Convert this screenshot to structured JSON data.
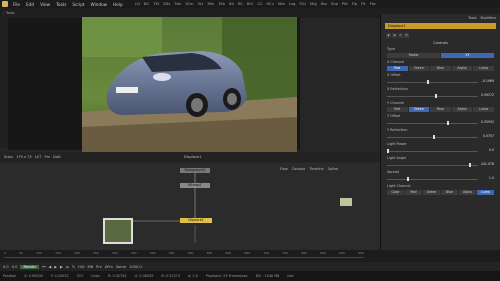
{
  "menubar": {
    "items": [
      "File",
      "Edit",
      "View",
      "Tools",
      "Script",
      "Window",
      "Help"
    ],
    "tool_labels": [
      "LD",
      "BG",
      "TXt",
      "3Dx",
      "3Im",
      "3Cm",
      "3Lt",
      "3Rn",
      "3Sh",
      "Blr",
      "BC",
      "BrC",
      "CC",
      "HCv",
      "Msk",
      "Lng",
      "FLU",
      "Mrg",
      "Rsz",
      "Shp",
      "Pht",
      "Flp",
      "Flt",
      "Flw"
    ]
  },
  "toolbar": {
    "items": [
      "Tools",
      "",
      "",
      "",
      "",
      "",
      "",
      "",
      "",
      "",
      "Tools",
      "Modifiers",
      "",
      "",
      "Script"
    ],
    "right_tabs": [
      "Tools",
      "Modifiers"
    ]
  },
  "viewer": {
    "zoom": "Subv",
    "res": "179 x 75",
    "lut": "LUT",
    "proxy": "Prx",
    "dod": "DoD",
    "node_label": "Displace1"
  },
  "flow": {
    "tabs": [
      "Flow",
      "Console",
      "Timeline",
      "Spline"
    ],
    "nodes": [
      {
        "label": "Background1"
      },
      {
        "label": "Bitmap1"
      },
      {
        "label": "Displace1"
      }
    ]
  },
  "inspector": {
    "tabs": [
      "Tools",
      "Modifiers"
    ],
    "node_title": "Displace1",
    "section": "Controls",
    "type_label": "Type",
    "type_options": [
      "Radial",
      "XY"
    ],
    "type_selected": "XY",
    "x_channel_label": "X Channel",
    "channel_buttons": [
      "Red",
      "Green",
      "Blue",
      "Alpha",
      "Luma"
    ],
    "x_channel_selected": "Red",
    "x_offset_label": "X Offset",
    "x_offset_value": "-0.1969",
    "x_refraction_label": "X Refraction",
    "x_refraction_value": "0.09372",
    "y_channel_label": "Y Channel",
    "y_channel_selected": "Green",
    "y_offset_label": "Y Offset",
    "y_offset_value": "0.35932",
    "y_refraction_label": "Y Refraction",
    "y_refraction_value": "0.0707",
    "light_power_label": "Light Power",
    "light_power_value": "0.0",
    "light_angle_label": "Light Angle",
    "light_angle_value": "441.076",
    "spread_label": "Spread",
    "spread_value": "1.0",
    "light_channel_label": "Light Channel",
    "light_channel_buttons": [
      "Color",
      "Red",
      "Green",
      "Blue",
      "Alpha",
      "Luma"
    ],
    "light_channel_selected": "Luma"
  },
  "timeline": {
    "start": "0.0",
    "end": "1000.0",
    "current": "0.0",
    "render_label": "Render",
    "hiq": "HiQ",
    "mb": "MB",
    "prx": "Prx",
    "aprx": "APrx",
    "some": "Some",
    "ticks": [
      "0",
      "50",
      "100",
      "150",
      "200",
      "250",
      "300",
      "350",
      "400",
      "450",
      "500",
      "550",
      "600",
      "650",
      "700",
      "750",
      "800",
      "850",
      "900",
      "950"
    ]
  },
  "status": {
    "position": "Position",
    "x_val": "X: 0.90000",
    "y_val": "Y: 0.20022",
    "idx": "321",
    "color": "Color",
    "r": "R: 0.42745",
    "g": "G: 0.38039",
    "b": "B: 0.31373",
    "a": "A: 1.0",
    "playback": "Playback: 25 Frames/sec",
    "mem": "8% · 1346 MB",
    "idle": "Idle"
  },
  "colors": {
    "accent_gold": "#c89a2a",
    "button_blue": "#3f68b4",
    "node_gold": "#e0c04a"
  }
}
